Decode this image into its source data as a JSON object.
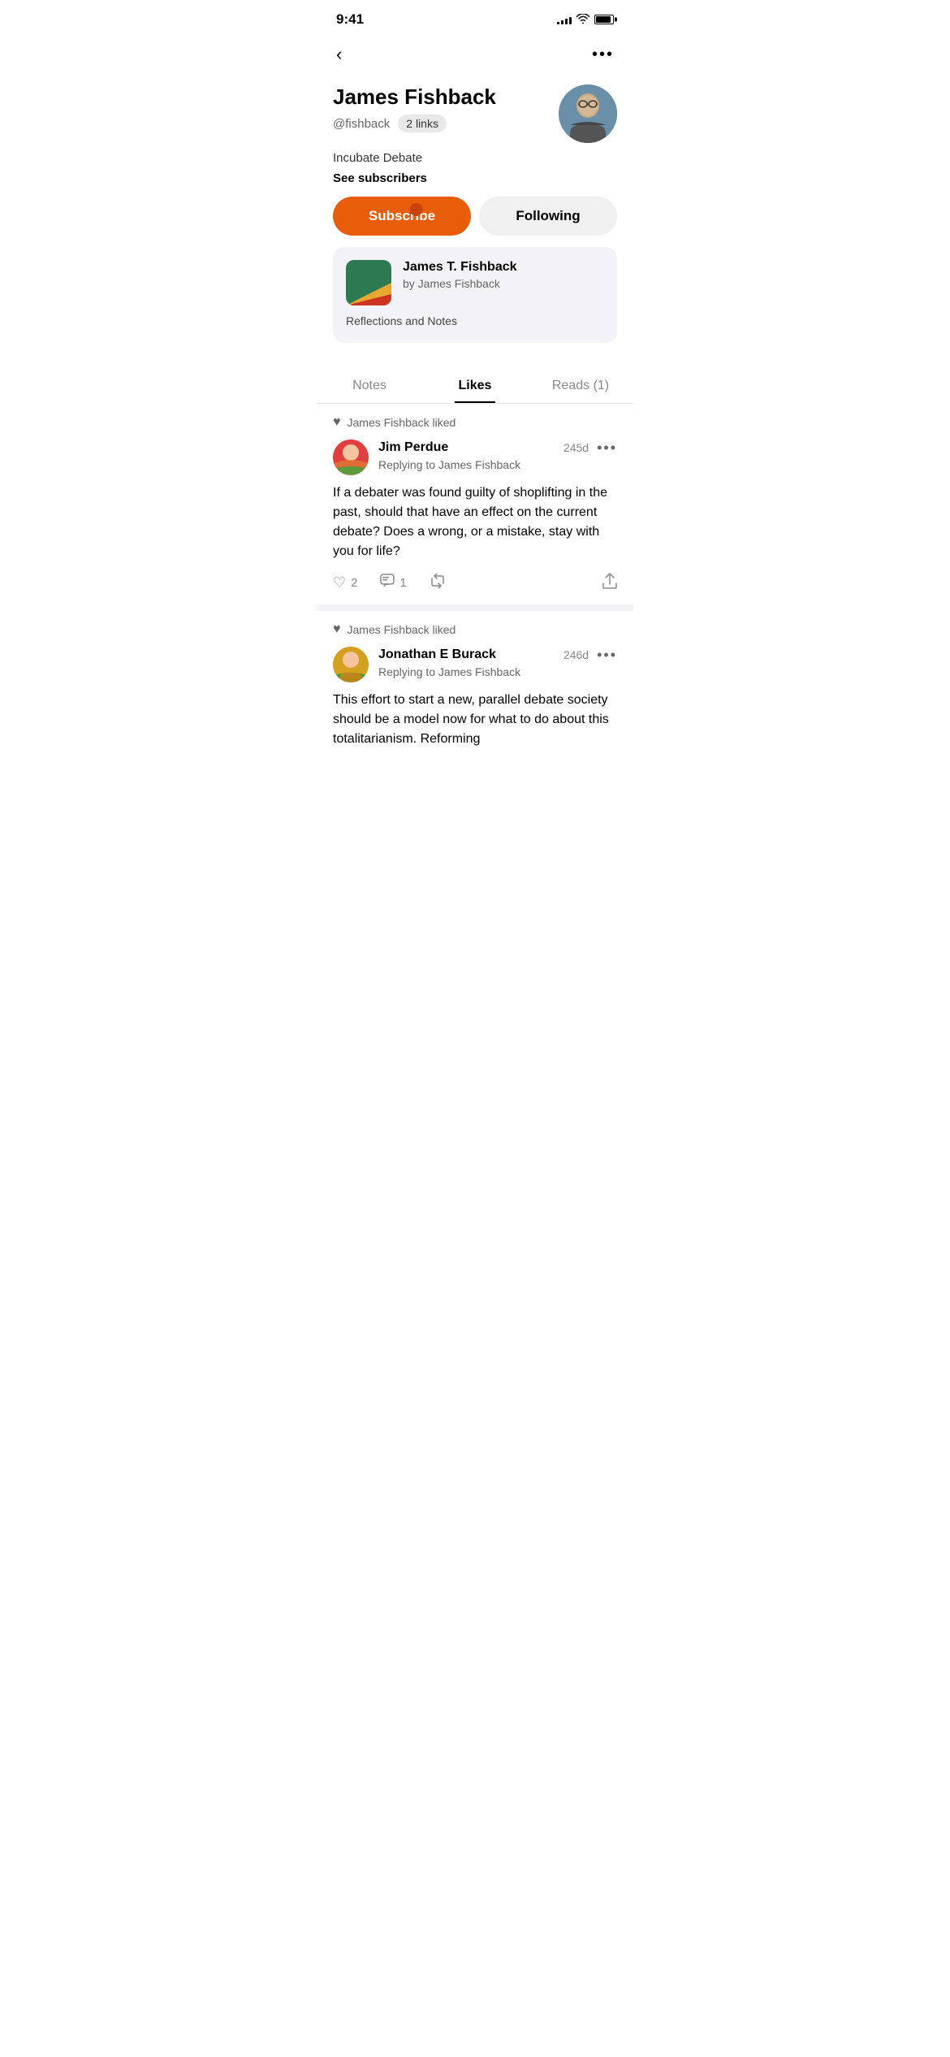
{
  "statusBar": {
    "time": "9:41",
    "signalBars": [
      3,
      5,
      7,
      9,
      11
    ],
    "wifiLabel": "wifi",
    "batteryLabel": "battery"
  },
  "nav": {
    "backLabel": "‹",
    "moreLabel": "•••"
  },
  "profile": {
    "name": "James Fishback",
    "handle": "@fishback",
    "linksLabel": "2 links",
    "bio": "Incubate Debate",
    "seeSubscribers": "See subscribers",
    "subscribeButton": "Subscribe",
    "followingButton": "Following"
  },
  "newsletter": {
    "title": "James T. Fishback",
    "author": "by James Fishback",
    "description": "Reflections and Notes"
  },
  "tabs": {
    "notes": "Notes",
    "likes": "Likes",
    "reads": "Reads (1)"
  },
  "feed": [
    {
      "likedBy": "James Fishback liked",
      "author": "Jim Perdue",
      "time": "245d",
      "replyTo": "Replying to James Fishback",
      "content": "If a debater was found guilty of shoplifting in the past, should that have an effect on the current debate? Does a wrong, or a mistake, stay with you for life?",
      "likes": "2",
      "comments": "1",
      "avatarType": "jim"
    },
    {
      "likedBy": "James Fishback liked",
      "author": "Jonathan E Burack",
      "time": "246d",
      "replyTo": "Replying to James Fishback",
      "content": "This effort to start a new, parallel debate society should be a model now for what to do about this totalitarianism. Reforming",
      "likes": "",
      "comments": "",
      "avatarType": "jonathan"
    }
  ],
  "icons": {
    "heart": "♡",
    "heartFilled": "♥",
    "comment": "💬",
    "restack": "↻",
    "share": "↑"
  }
}
